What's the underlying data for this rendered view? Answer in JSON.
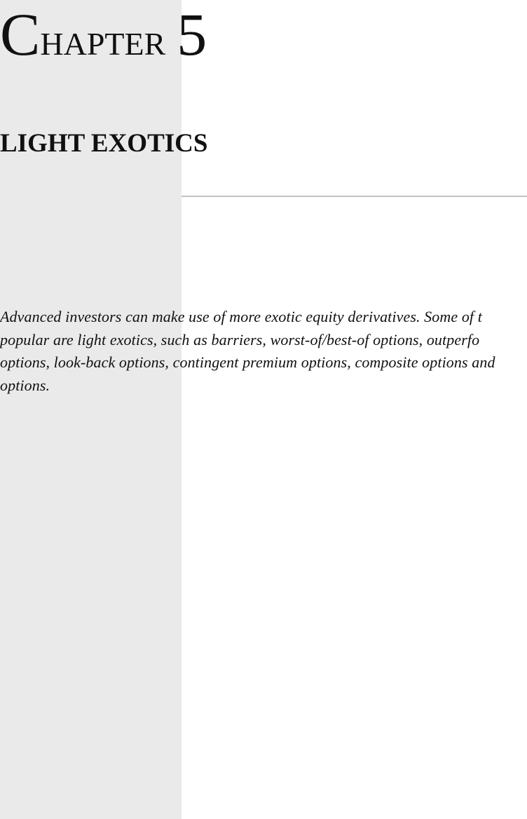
{
  "chapter": {
    "label_initial": "C",
    "label_rest": "HAPTER",
    "number": "5",
    "title": "LIGHT EXOTICS"
  },
  "abstract": {
    "lines": [
      "Advanced investors can make use of more exotic equity derivatives. Some of t",
      "popular are light exotics, such as barriers, worst-of/best-of options, outperfo",
      "options, look-back options, contingent premium options, composite options and",
      "options."
    ]
  }
}
